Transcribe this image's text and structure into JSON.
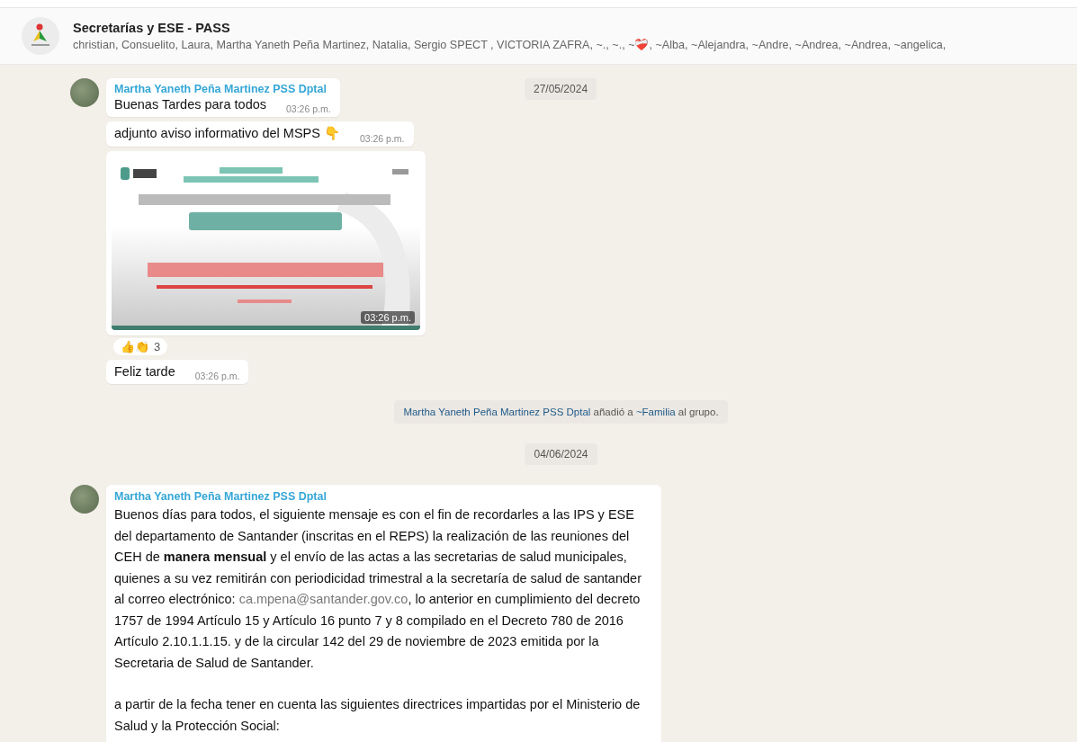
{
  "header": {
    "title": "Secretarías y ESE - PASS",
    "members": "christian, Consuelito, Laura, Martha Yaneth Peña Martinez, Natalia, Sergio SPECT , VICTORIA ZAFRA, ~., ~., ~❤️‍🩹, ~Alba, ~Alejandra, ~Andre, ~Andrea, ~Andrea, ~angelica,"
  },
  "sticky_date": "27/05/2024",
  "events": [
    {
      "kind": "group",
      "sender": "Martha Yaneth Peña Martinez PSS Dptal",
      "messages": [
        {
          "kind": "text",
          "text": "Buenas Tardes para todos",
          "time": "03:26 p.m."
        },
        {
          "kind": "text",
          "text": "adjunto aviso informativo del MSPS 👇",
          "time": "03:26 p.m."
        },
        {
          "time": "03:26 p.m.",
          "reactions": {
            "emojis": "👍👏",
            "count": "3"
          }
        },
        {
          "kind": "text",
          "text": "Feliz tarde",
          "time": "03:26 p.m."
        }
      ]
    },
    {
      "kind": "system",
      "segments": [
        {
          "kind": "link",
          "text": "Martha Yaneth Peña Martinez PSS Dptal"
        },
        {
          "kind": "text",
          "text": " añadió a "
        },
        {
          "kind": "link",
          "text": "~Familia"
        },
        {
          "kind": "text",
          "text": " al grupo."
        }
      ]
    },
    {
      "kind": "date",
      "text": "04/06/2024"
    },
    {
      "kind": "group",
      "sender": "Martha Yaneth Peña Martinez PSS Dptal",
      "messages": [
        {
          "kind": "long",
          "paragraphs": [
            [
              {
                "kind": "text",
                "text": "Buenos días para todos, el siguiente mensaje es con el fin de recordarles a las IPS y ESE del departamento de Santander (inscritas en el REPS) la realización de las reuniones del CEH de **manera mensual** y el envío de las actas a las secretarias de salud municipales, quienes a su vez remitirán con periodicidad trimestral a la secretaría de salud de santander al correo electrónico: "
              },
              {
                "kind": "link",
                "text": "ca.mpena@santander.gov.co"
              },
              {
                "kind": "text",
                "text": ", lo anterior en cumplimiento del decreto 1757 de 1994 Artículo 15 y Artículo 16 punto 7 y 8 compilado en el Decreto 780 de 2016 Artículo 2.10.1.1.15. y de la circular 142 del 29 de noviembre de 2023 emitida por la Secretaria de Salud de Santander."
              }
            ],
            [
              {
                "kind": "text",
                "text": "a partir de la fecha tener en cuenta las siguientes directrices impartidas por el Ministerio de Salud y la Protección Social:"
              }
            ]
          ]
        }
      ]
    }
  ]
}
